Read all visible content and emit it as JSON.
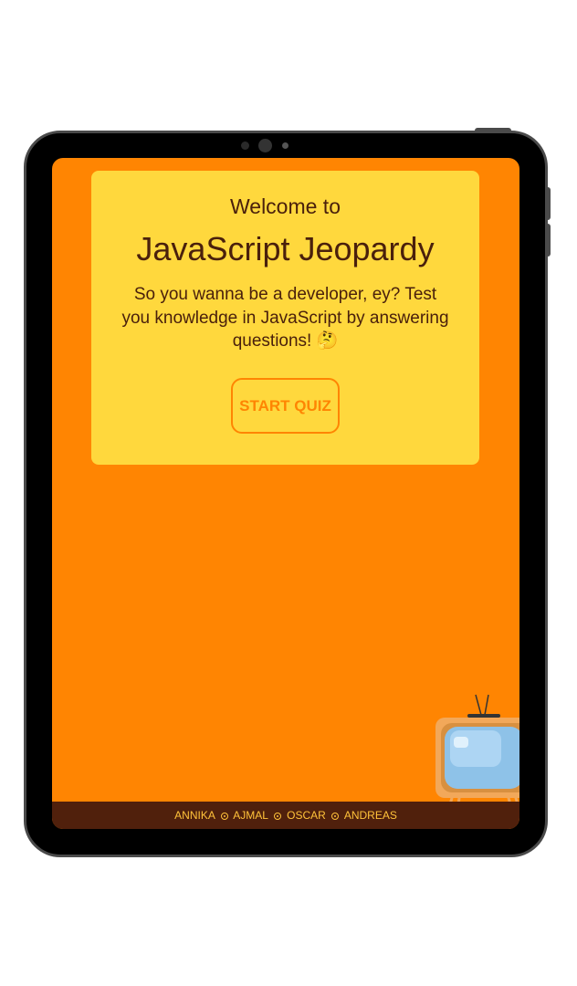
{
  "welcome": {
    "intro": "Welcome to",
    "title": "JavaScript Jeopardy",
    "subtitle": "So you wanna be a developer, ey? Test you knowledge in JavaScript by answering questions! 🤔",
    "start_button": "START QUIZ"
  },
  "footer": {
    "names": [
      "ANNIKA",
      "AJMAL",
      "OSCAR",
      "ANDREAS"
    ]
  },
  "colors": {
    "background": "#ff8502",
    "card": "#ffd83d",
    "text": "#4a200c",
    "footer_bg": "#50200c",
    "footer_text": "#ffc23a"
  },
  "icons": {
    "mascot": "retro-tv-icon",
    "separator": "dot-separator-icon"
  }
}
